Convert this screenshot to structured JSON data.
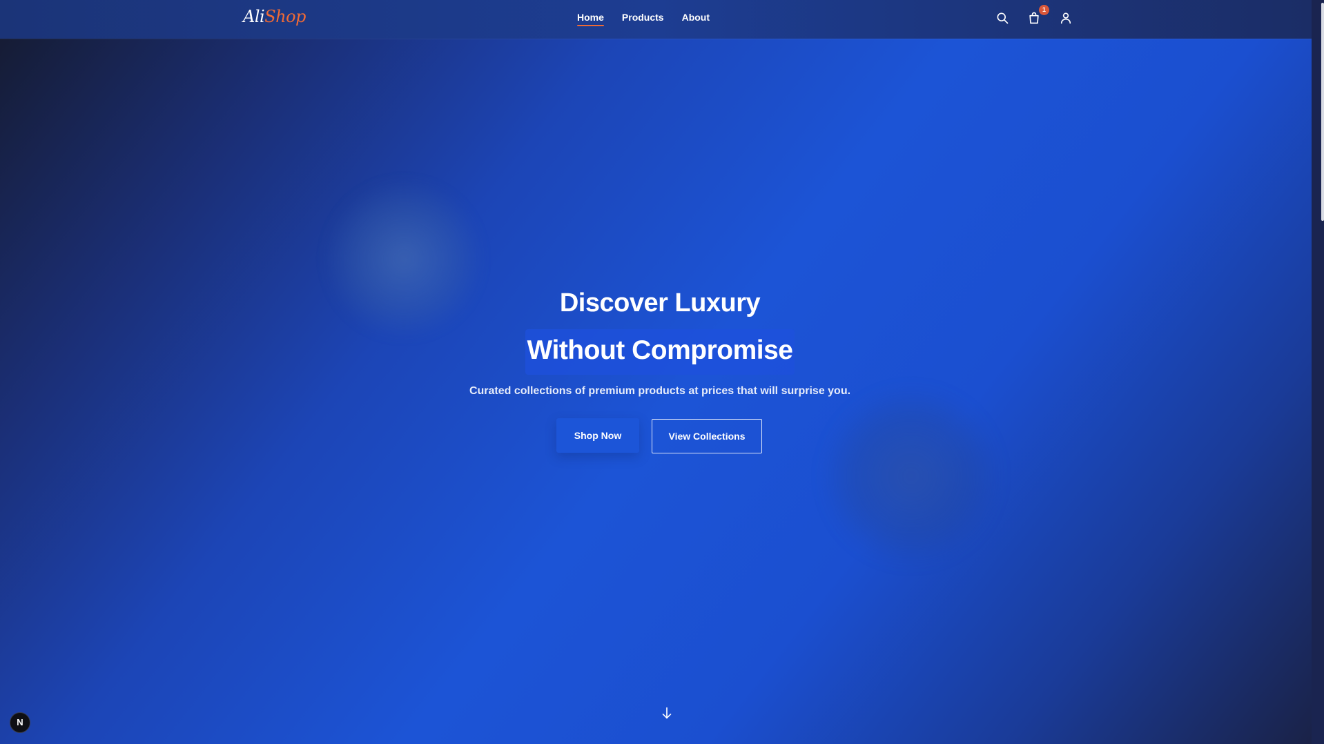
{
  "header": {
    "logo": {
      "part1": "Ali",
      "part2": "Shop"
    },
    "nav": [
      {
        "label": "Home",
        "active": true
      },
      {
        "label": "Products",
        "active": false
      },
      {
        "label": "About",
        "active": false
      }
    ],
    "icons": {
      "search": "search-icon",
      "cart": "shopping-bag-icon",
      "account": "user-icon"
    },
    "cart_count": "1"
  },
  "hero": {
    "title_line1": "Discover Luxury",
    "title_line2": "Without Compromise",
    "subtitle": "Curated collections of premium products at prices that will surprise you.",
    "primary_cta": "Shop Now",
    "secondary_cta": "View Collections",
    "scroll_icon": "arrow-down-icon"
  },
  "dev_badge": {
    "label": "N"
  },
  "colors": {
    "accent": "#f06a35",
    "brand_blue": "#1c55d8",
    "header_bg": "#1d3d92"
  }
}
